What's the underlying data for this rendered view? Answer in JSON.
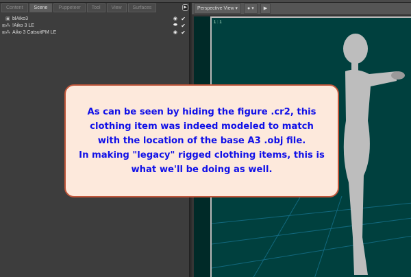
{
  "tabs": [
    "Content",
    "Scene",
    "Puppeteer",
    "Tool",
    "View",
    "Surfaces"
  ],
  "active_tab": "Scene",
  "scene_items": [
    {
      "label": "blAiko3",
      "icon": "box-icon"
    },
    {
      "label": "!Aiko 3 LE",
      "icon": "figure-icon"
    },
    {
      "label": "Aiko 3 CatsuitPM LE",
      "icon": "figure-icon"
    }
  ],
  "viewport": {
    "camera": "Perspective View",
    "label": "1 : 1"
  },
  "callout": {
    "lines": [
      "As can be seen by hiding the figure .cr2, this",
      "clothing item was indeed modeled to match",
      "with the location of the base A3 .obj file.",
      "In making \"legacy\" rigged clothing items, this is",
      "what we'll be doing as well."
    ]
  },
  "colors": {
    "callout_text": "#1010e8",
    "callout_bg": "#fde9dc",
    "viewport_bg": "#00403e"
  }
}
